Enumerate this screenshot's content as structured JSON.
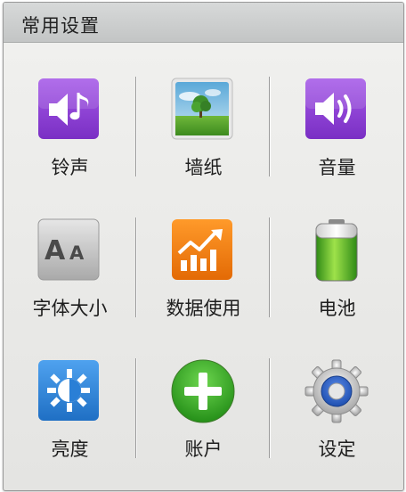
{
  "header": {
    "title": "常用设置"
  },
  "items": [
    {
      "label": "铃声",
      "icon": "ringtone-icon"
    },
    {
      "label": "墙纸",
      "icon": "wallpaper-icon"
    },
    {
      "label": "音量",
      "icon": "volume-icon"
    },
    {
      "label": "字体大小",
      "icon": "font-size-icon"
    },
    {
      "label": "数据使用",
      "icon": "data-usage-icon"
    },
    {
      "label": "电池",
      "icon": "battery-icon"
    },
    {
      "label": "亮度",
      "icon": "brightness-icon"
    },
    {
      "label": "账户",
      "icon": "account-icon"
    },
    {
      "label": "设定",
      "icon": "settings-icon"
    }
  ],
  "colors": {
    "purple": "#8a3fd0",
    "orange": "#f07a10",
    "green": "#3aa033",
    "blue": "#2e86d8"
  }
}
